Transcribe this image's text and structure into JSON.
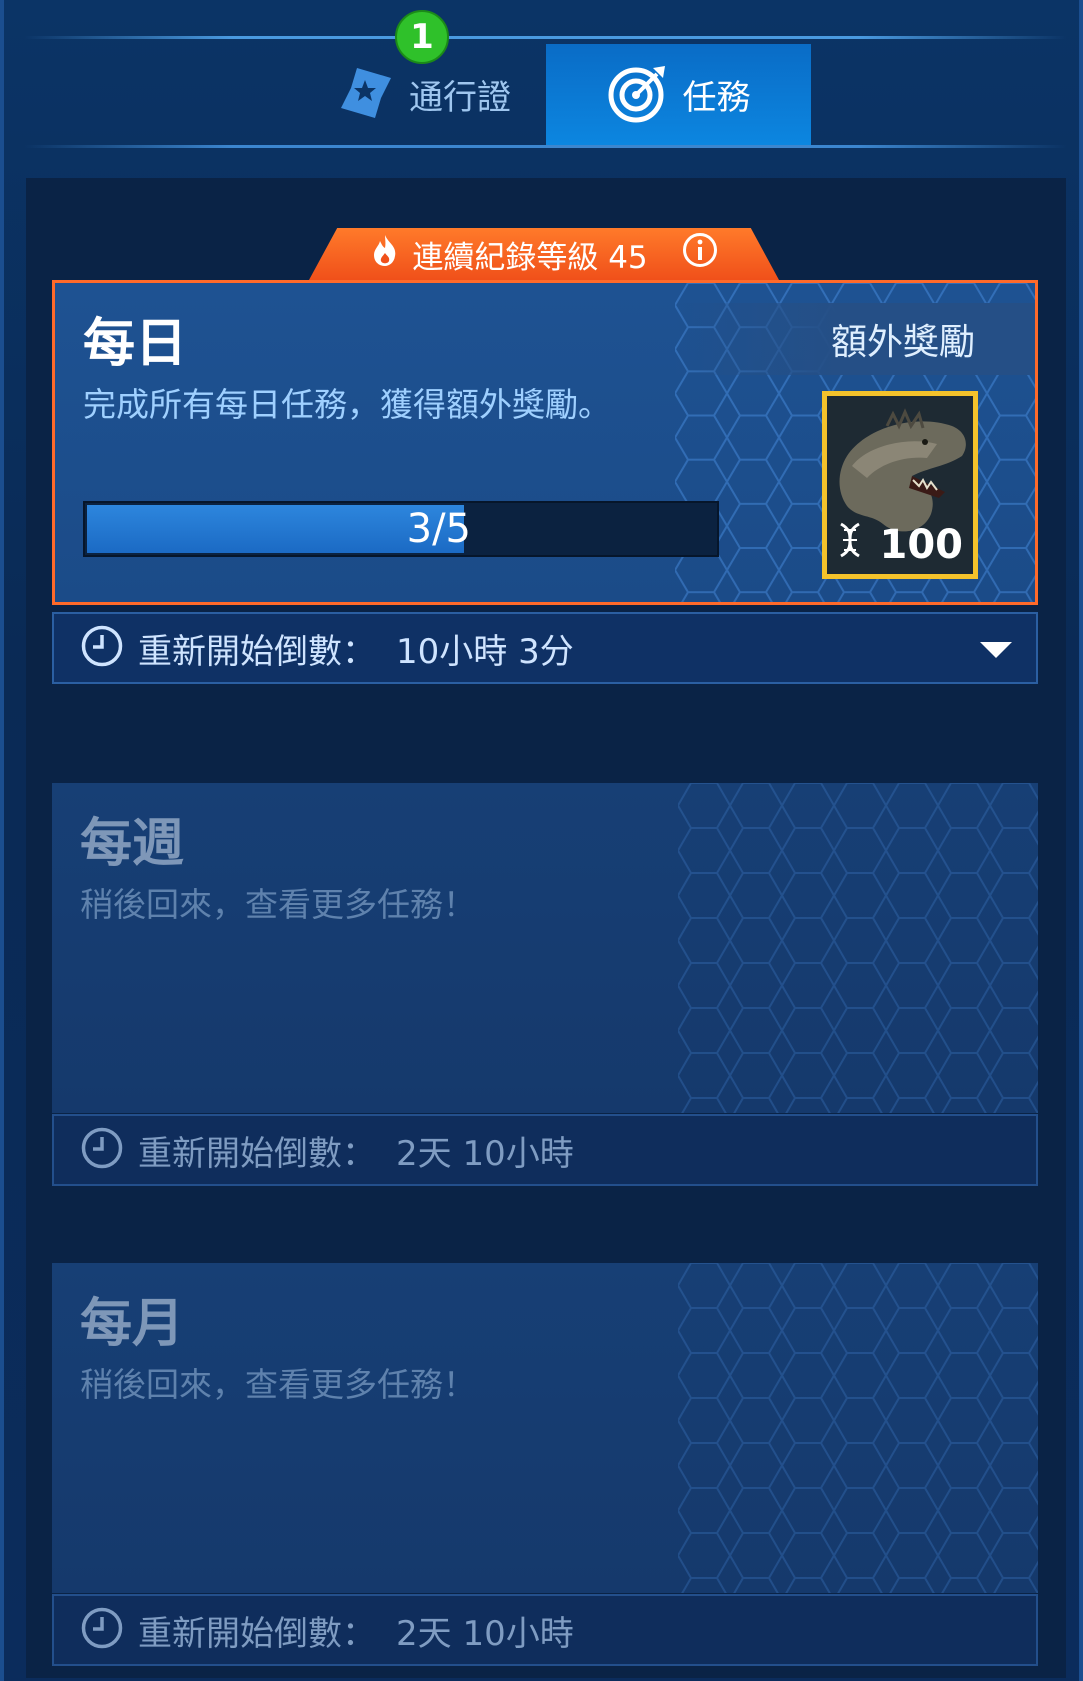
{
  "tabs": {
    "pass_label": "通行證",
    "missions_label": "任務",
    "pass_badge": "1",
    "active": "missions"
  },
  "streak": {
    "label": "連續紀錄等級 45"
  },
  "daily": {
    "title": "每日",
    "description": "完成所有每日任務，獲得額外獎勵。",
    "bonus_label": "額外獎勵",
    "progress_text": "3/5",
    "progress_fraction": 0.6,
    "reward_amount": "100",
    "reward_icon": "dna-icon",
    "timer_label": "重新開始倒數：",
    "timer_value": "10小時 3分"
  },
  "weekly": {
    "title": "每週",
    "description": "稍後回來，查看更多任務！",
    "timer_label": "重新開始倒數：",
    "timer_value": "2天 10小時"
  },
  "monthly": {
    "title": "每月",
    "description": "稍後回來，查看更多任務！",
    "timer_label": "重新開始倒數：",
    "timer_value": "2天 10小時"
  },
  "colors": {
    "accent_blue": "#0c86e0",
    "streak_orange": "#f0501a",
    "badge_green": "#2fc12a",
    "reward_gold": "#f4c22b"
  }
}
